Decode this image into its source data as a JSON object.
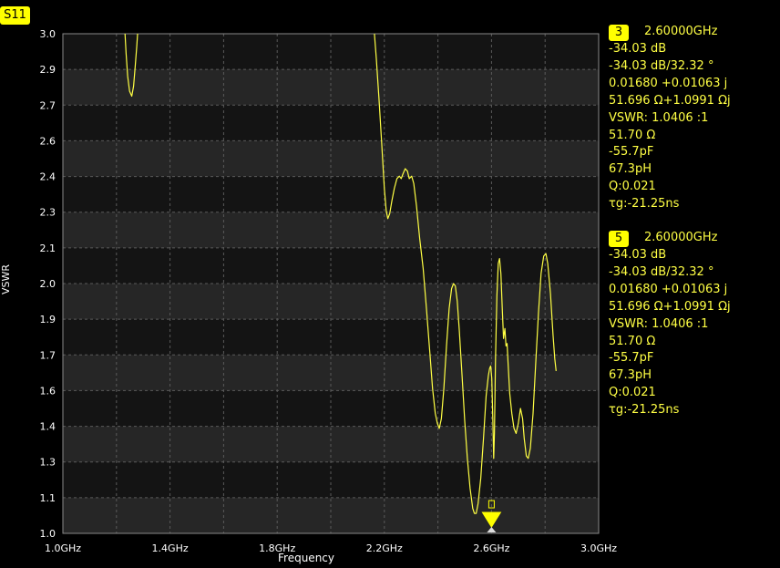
{
  "trace_label": "S11",
  "chart_data": {
    "type": "line",
    "xlabel": "Frequency",
    "ylabel": "VSWR",
    "xlim": [
      1.0,
      3.0
    ],
    "ylim": [
      1.0,
      3.0
    ],
    "x_ticks": [
      1.0,
      1.4,
      1.8,
      2.2,
      2.6,
      3.0
    ],
    "x_tick_labels": [
      "1.0GHz",
      "1.4GHz",
      "1.8GHz",
      "2.2GHz",
      "2.6GHz",
      "3.0GHz"
    ],
    "y_ticks": [
      1.0,
      1.1,
      1.3,
      1.4,
      1.6,
      1.7,
      1.9,
      2.0,
      2.1,
      2.3,
      2.4,
      2.6,
      2.7,
      2.9,
      3.0
    ],
    "y_tick_labels": [
      "1.0",
      "1.1",
      "1.3",
      "1.4",
      "1.6",
      "1.7",
      "1.9",
      "2.0",
      "2.1",
      "2.3",
      "2.4",
      "2.6",
      "2.7",
      "2.9",
      "3.0"
    ],
    "grid": true,
    "trace_color": "#ffff44",
    "series": [
      {
        "segments": [
          [
            [
              1.232,
              3.0
            ],
            [
              1.236,
              2.92
            ],
            [
              1.242,
              2.83
            ],
            [
              1.249,
              2.77
            ],
            [
              1.257,
              2.75
            ],
            [
              1.264,
              2.79
            ],
            [
              1.27,
              2.87
            ],
            [
              1.276,
              2.95
            ],
            [
              1.279,
              3.0
            ]
          ],
          [
            [
              2.163,
              3.0
            ],
            [
              2.17,
              2.9
            ],
            [
              2.18,
              2.74
            ],
            [
              2.19,
              2.56
            ],
            [
              2.2,
              2.38
            ],
            [
              2.207,
              2.29
            ],
            [
              2.213,
              2.26
            ],
            [
              2.22,
              2.28
            ],
            [
              2.228,
              2.33
            ],
            [
              2.237,
              2.38
            ],
            [
              2.247,
              2.42
            ],
            [
              2.256,
              2.43
            ],
            [
              2.263,
              2.42
            ],
            [
              2.27,
              2.44
            ],
            [
              2.278,
              2.46
            ],
            [
              2.286,
              2.45
            ],
            [
              2.293,
              2.42
            ],
            [
              2.302,
              2.43
            ],
            [
              2.31,
              2.4
            ],
            [
              2.32,
              2.31
            ],
            [
              2.332,
              2.18
            ],
            [
              2.345,
              2.06
            ],
            [
              2.357,
              1.9
            ],
            [
              2.37,
              1.72
            ],
            [
              2.38,
              1.58
            ],
            [
              2.39,
              1.48
            ],
            [
              2.398,
              1.44
            ],
            [
              2.405,
              1.42
            ],
            [
              2.413,
              1.46
            ],
            [
              2.422,
              1.58
            ],
            [
              2.432,
              1.75
            ],
            [
              2.442,
              1.9
            ],
            [
              2.451,
              1.98
            ],
            [
              2.458,
              2.0
            ],
            [
              2.465,
              1.99
            ],
            [
              2.472,
              1.93
            ],
            [
              2.48,
              1.81
            ],
            [
              2.49,
              1.63
            ],
            [
              2.5,
              1.45
            ],
            [
              2.51,
              1.3
            ],
            [
              2.52,
              1.18
            ],
            [
              2.53,
              1.1
            ],
            [
              2.536,
              1.08
            ],
            [
              2.543,
              1.08
            ],
            [
              2.55,
              1.12
            ],
            [
              2.56,
              1.22
            ],
            [
              2.57,
              1.38
            ],
            [
              2.58,
              1.55
            ],
            [
              2.588,
              1.63
            ],
            [
              2.593,
              1.66
            ],
            [
              2.597,
              1.67
            ],
            [
              2.601,
              1.62
            ],
            [
              2.605,
              1.45
            ],
            [
              2.608,
              1.3
            ],
            [
              2.611,
              1.4
            ],
            [
              2.615,
              1.7
            ],
            [
              2.62,
              1.95
            ],
            [
              2.625,
              2.08
            ],
            [
              2.63,
              2.1
            ],
            [
              2.635,
              2.04
            ],
            [
              2.64,
              1.9
            ],
            [
              2.645,
              1.78
            ],
            [
              2.65,
              1.82
            ],
            [
              2.654,
              1.75
            ],
            [
              2.658,
              1.76
            ],
            [
              2.662,
              1.68
            ],
            [
              2.668,
              1.56
            ],
            [
              2.676,
              1.48
            ],
            [
              2.684,
              1.42
            ],
            [
              2.692,
              1.4
            ],
            [
              2.7,
              1.44
            ],
            [
              2.708,
              1.5
            ],
            [
              2.716,
              1.46
            ],
            [
              2.722,
              1.38
            ],
            [
              2.73,
              1.31
            ],
            [
              2.737,
              1.3
            ],
            [
              2.745,
              1.34
            ],
            [
              2.755,
              1.48
            ],
            [
              2.765,
              1.68
            ],
            [
              2.775,
              1.88
            ],
            [
              2.785,
              2.04
            ],
            [
              2.795,
              2.11
            ],
            [
              2.803,
              2.12
            ],
            [
              2.81,
              2.08
            ],
            [
              2.82,
              1.96
            ],
            [
              2.83,
              1.79
            ],
            [
              2.836,
              1.7
            ],
            [
              2.841,
              1.65
            ]
          ]
        ]
      }
    ]
  },
  "markers": [
    {
      "id": "3",
      "freq": "2.60000GHz",
      "lines": [
        "-34.03 dB",
        "-34.03 dB/32.32 °",
        "0.01680 +0.01063 j",
        "51.696 Ω+1.0991 Ωj",
        "VSWR: 1.0406 :1",
        "51.70 Ω",
        "-55.7pF",
        "67.3pH",
        "Q:0.021",
        "τg:-21.25ns"
      ]
    },
    {
      "id": "5",
      "freq": "2.60000GHz",
      "lines": [
        "-34.03 dB",
        "-34.03 dB/32.32 °",
        "0.01680 +0.01063 j",
        "51.696 Ω+1.0991 Ωj",
        "VSWR: 1.0406 :1",
        "51.70 Ω",
        "-55.7pF",
        "67.3pH",
        "Q:0.021",
        "τg:-21.25ns"
      ]
    }
  ],
  "plot_marker": {
    "x": 2.6,
    "y": 1.04,
    "label": "1"
  }
}
